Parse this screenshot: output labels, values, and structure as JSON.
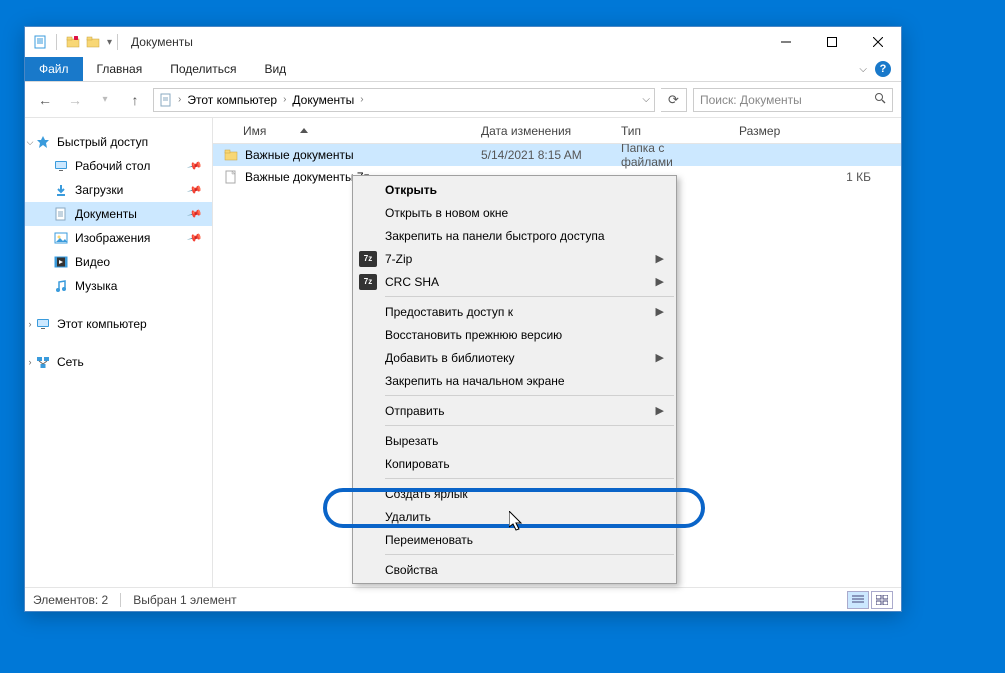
{
  "titlebar": {
    "title": "Документы"
  },
  "ribbon": {
    "file": "Файл",
    "tabs": [
      "Главная",
      "Поделиться",
      "Вид"
    ]
  },
  "breadcrumb": {
    "items": [
      "Этот компьютер",
      "Документы"
    ]
  },
  "search": {
    "placeholder": "Поиск: Документы"
  },
  "sidebar": {
    "quick_access": {
      "label": "Быстрый доступ",
      "items": [
        {
          "label": "Рабочий стол",
          "icon": "desktop",
          "pinned": true
        },
        {
          "label": "Загрузки",
          "icon": "download",
          "pinned": true
        },
        {
          "label": "Документы",
          "icon": "document",
          "pinned": true,
          "selected": true
        },
        {
          "label": "Изображения",
          "icon": "image",
          "pinned": true
        },
        {
          "label": "Видео",
          "icon": "video",
          "pinned": false
        },
        {
          "label": "Музыка",
          "icon": "music",
          "pinned": false
        }
      ]
    },
    "this_pc": {
      "label": "Этот компьютер"
    },
    "network": {
      "label": "Сеть"
    }
  },
  "columns": {
    "name": "Имя",
    "date": "Дата изменения",
    "type": "Тип",
    "size": "Размер"
  },
  "files": [
    {
      "name": "Важные документы",
      "date": "5/14/2021 8:15 AM",
      "type": "Папка с файлами",
      "size": "",
      "icon": "folder",
      "selected": true
    },
    {
      "name": "Важные документы.7z",
      "date": "",
      "type": "",
      "size": "1 КБ",
      "icon": "file",
      "selected": false
    }
  ],
  "status": {
    "count": "Элементов: 2",
    "selection": "Выбран 1 элемент"
  },
  "context_menu": {
    "items": [
      {
        "label": "Открыть",
        "bold": true
      },
      {
        "label": "Открыть в новом окне"
      },
      {
        "label": "Закрепить на панели быстрого доступа"
      },
      {
        "label": "7-Zip",
        "sub": true,
        "icon": "7z"
      },
      {
        "label": "CRC SHA",
        "sub": true,
        "icon": "7z"
      },
      {
        "sep": true
      },
      {
        "label": "Предоставить доступ к",
        "sub": true
      },
      {
        "label": "Восстановить прежнюю версию"
      },
      {
        "label": "Добавить в библиотеку",
        "sub": true
      },
      {
        "label": "Закрепить на начальном экране"
      },
      {
        "sep": true
      },
      {
        "label": "Отправить",
        "sub": true
      },
      {
        "sep": true
      },
      {
        "label": "Вырезать"
      },
      {
        "label": "Копировать"
      },
      {
        "sep": true
      },
      {
        "label": "Создать ярлык"
      },
      {
        "label": "Удалить",
        "highlighted": true
      },
      {
        "label": "Переименовать"
      },
      {
        "sep": true
      },
      {
        "label": "Свойства"
      }
    ]
  }
}
